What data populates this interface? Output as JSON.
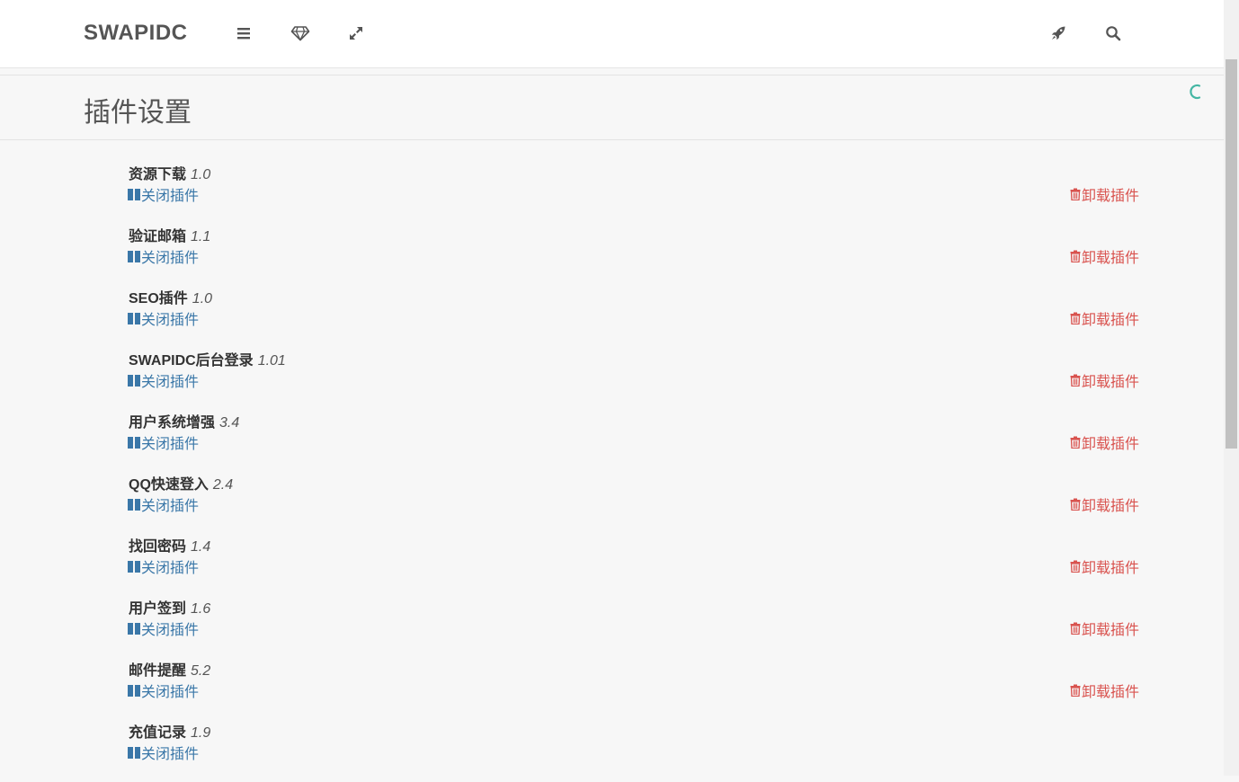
{
  "navbar": {
    "brand": "SWAPIDC",
    "icons": [
      "menu-icon",
      "diamond-icon",
      "expand-icon",
      "rocket-icon",
      "search-icon"
    ]
  },
  "page": {
    "title": "插件设置"
  },
  "colors": {
    "accent": "#45b6a4",
    "toggle_link": "#3a77a8",
    "uninstall_link": "#d9534f"
  },
  "plugins": [
    {
      "name": "资源下载",
      "version": "1.0",
      "toggle_label": "关闭插件",
      "uninstall_label": "卸载插件"
    },
    {
      "name": "验证邮箱",
      "version": "1.1",
      "toggle_label": "关闭插件",
      "uninstall_label": "卸载插件"
    },
    {
      "name": "SEO插件",
      "version": "1.0",
      "toggle_label": "关闭插件",
      "uninstall_label": "卸载插件"
    },
    {
      "name": "SWAPIDC后台登录",
      "version": "1.01",
      "toggle_label": "关闭插件",
      "uninstall_label": "卸载插件"
    },
    {
      "name": "用户系统增强",
      "version": "3.4",
      "toggle_label": "关闭插件",
      "uninstall_label": "卸载插件"
    },
    {
      "name": "QQ快速登入",
      "version": "2.4",
      "toggle_label": "关闭插件",
      "uninstall_label": "卸载插件"
    },
    {
      "name": "找回密码",
      "version": "1.4",
      "toggle_label": "关闭插件",
      "uninstall_label": "卸载插件"
    },
    {
      "name": "用户签到",
      "version": "1.6",
      "toggle_label": "关闭插件",
      "uninstall_label": "卸载插件"
    },
    {
      "name": "邮件提醒",
      "version": "5.2",
      "toggle_label": "关闭插件",
      "uninstall_label": "卸载插件"
    },
    {
      "name": "充值记录",
      "version": "1.9",
      "toggle_label": "关闭插件",
      "uninstall_label": ""
    }
  ]
}
